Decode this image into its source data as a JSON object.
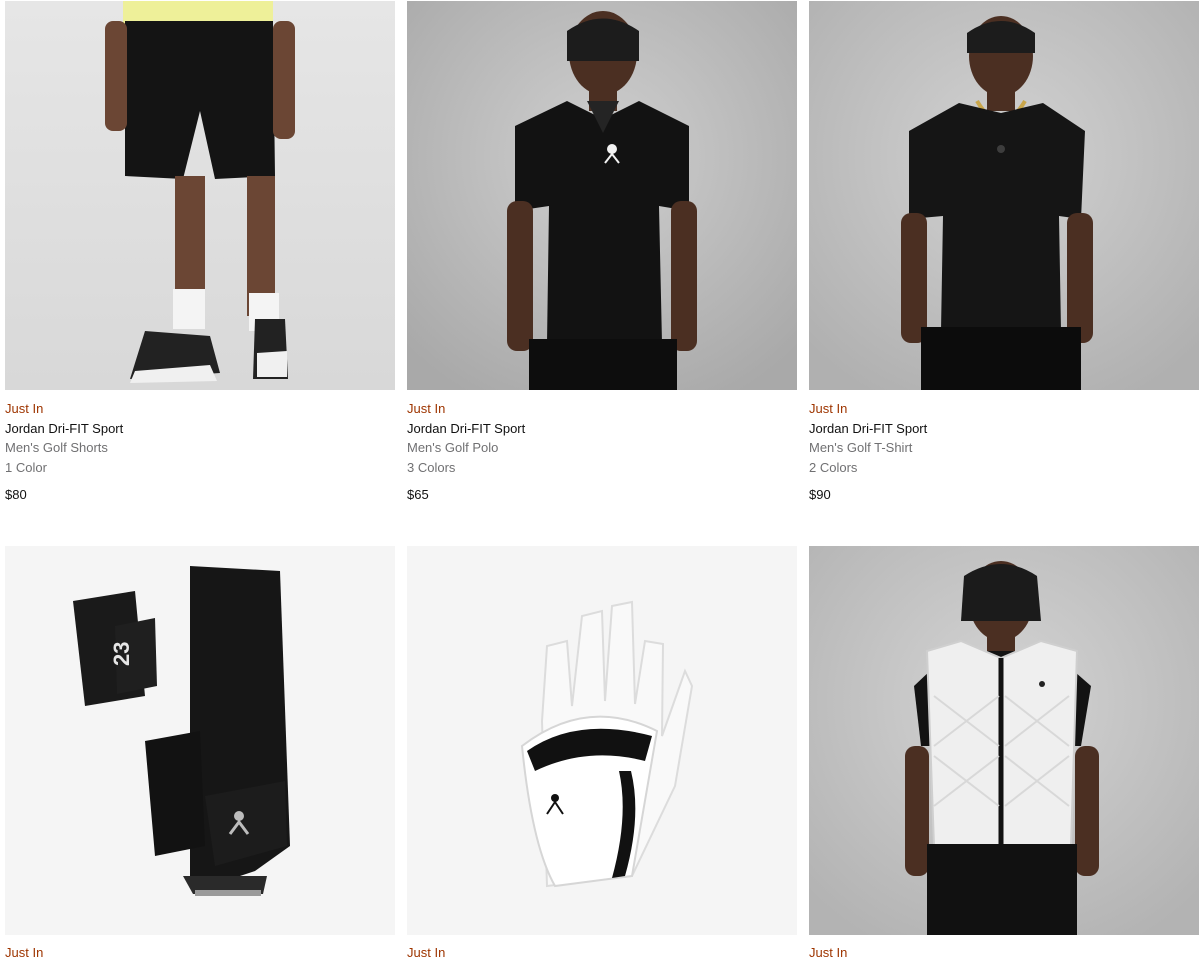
{
  "products": [
    {
      "badge": "Just In",
      "title": "Jordan Dri-FIT Sport",
      "subtitle": "Men's Golf Shorts",
      "colors": "1 Color",
      "price": "$80"
    },
    {
      "badge": "Just In",
      "title": "Jordan Dri-FIT Sport",
      "subtitle": "Men's Golf Polo",
      "colors": "3 Colors",
      "price": "$65"
    },
    {
      "badge": "Just In",
      "title": "Jordan Dri-FIT Sport",
      "subtitle": "Men's Golf T-Shirt",
      "colors": "2 Colors",
      "price": "$90"
    },
    {
      "badge": "Just In"
    },
    {
      "badge": "Just In"
    },
    {
      "badge": "Just In"
    }
  ],
  "bag_number": "23",
  "colors": {
    "badge": "#9e3500",
    "muted": "#707072"
  }
}
